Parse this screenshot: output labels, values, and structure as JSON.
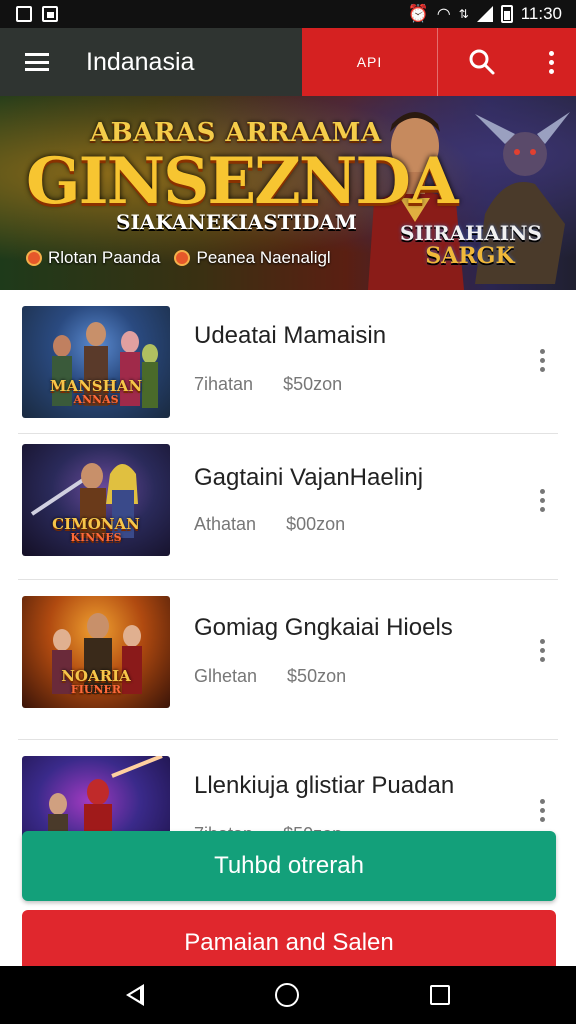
{
  "status_bar": {
    "time": "11:30",
    "icons": [
      "notification-icon",
      "image-icon",
      "alarm-icon",
      "wifi-icon",
      "data-icon",
      "signal-icon",
      "battery-icon"
    ]
  },
  "app_bar": {
    "title": "Indanasia",
    "api_label": "API",
    "icons": {
      "menu": "hamburger-menu-icon",
      "search": "search-icon",
      "more": "more-vert-icon"
    },
    "accent_color": "#d52121"
  },
  "banner": {
    "top_line": "ABARAS ARRAAMA",
    "main_title": "GINSEZNDA",
    "sub_line": "SIAKANEKIASTIDAM",
    "tags": [
      "Rlotan Paanda",
      "Peanea Naenaligl"
    ],
    "logo_line1": "SIIRAHAINS",
    "logo_line2": "SARGK"
  },
  "list": {
    "items": [
      {
        "title": "Udeatai Mamaisin",
        "meta_left": "7ihatan",
        "meta_right": "$50zon",
        "thumb_line1": "MANSHAN",
        "thumb_line2": "ANNAS"
      },
      {
        "title": "Gagtaini VajanHaelinj",
        "meta_left": "Athatan",
        "meta_right": "$00zon",
        "thumb_line1": "CIMONAN",
        "thumb_line2": "KINNES"
      },
      {
        "title": "Gomiag Gngkaiai Hioels",
        "meta_left": "Glhetan",
        "meta_right": "$50zon",
        "thumb_line1": "NOARIA",
        "thumb_line2": "FIUNER"
      },
      {
        "title": "Llenkiuja glistiar Puadan",
        "meta_left": "7ihatan",
        "meta_right": "$50zon",
        "thumb_line1": "",
        "thumb_line2": ""
      }
    ]
  },
  "actions": {
    "primary_label": "Tuhbd otrerah",
    "primary_color": "#13a07a",
    "secondary_label": "Pamaian and Salen",
    "secondary_color": "#e0272d"
  },
  "nav_bar": {
    "icons": [
      "back-icon",
      "home-icon",
      "recents-icon"
    ]
  }
}
